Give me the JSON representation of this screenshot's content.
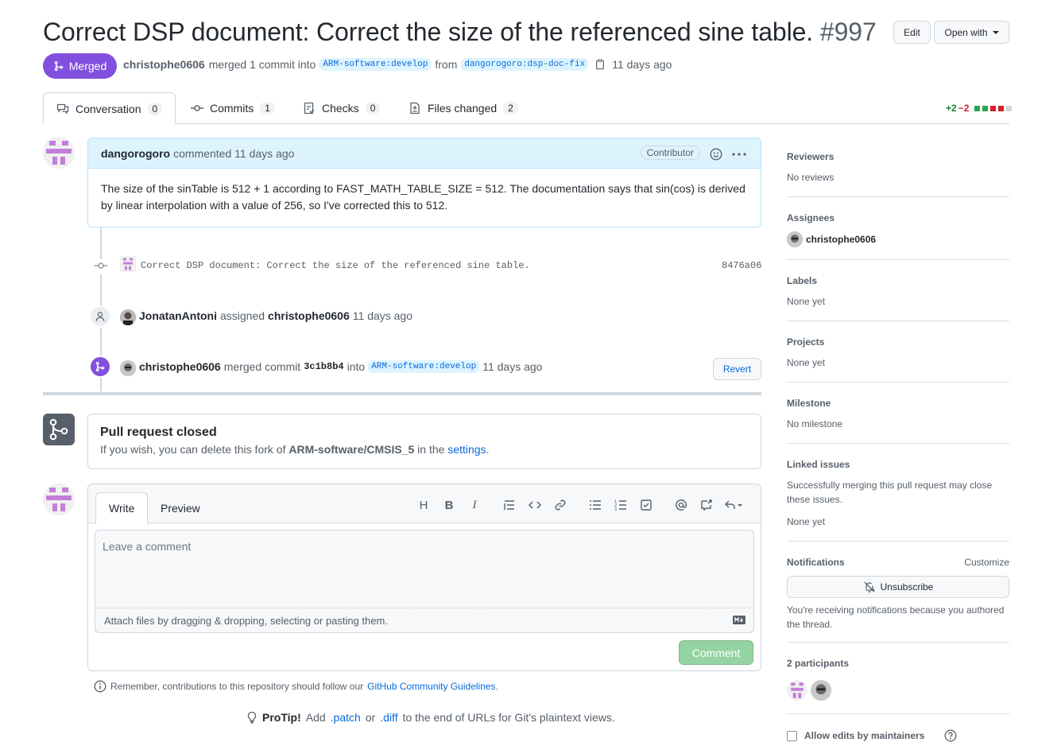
{
  "header": {
    "title": "Correct DSP document: Correct the size of the referenced sine table.",
    "number": "#997",
    "edit_label": "Edit",
    "open_with_label": "Open with"
  },
  "status": {
    "state": "Merged",
    "author": "christophe0606",
    "text_merged": "merged 1 commit into",
    "base_branch": "ARM-software:develop",
    "text_from": "from",
    "head_branch": "dangorogoro:dsp-doc-fix",
    "time": "11 days ago"
  },
  "tabs": [
    {
      "label": "Conversation",
      "count": "0"
    },
    {
      "label": "Commits",
      "count": "1"
    },
    {
      "label": "Checks",
      "count": "0"
    },
    {
      "label": "Files changed",
      "count": "2"
    }
  ],
  "diffstat": {
    "additions": "+2",
    "deletions": "−2"
  },
  "comment": {
    "author": "dangorogoro",
    "action": "commented 11 days ago",
    "role": "Contributor",
    "body": "The size of the sinTable is 512 + 1 according to FAST_MATH_TABLE_SIZE = 512. The documentation says that sin(cos) is derived by linear interpolation with a value of 256, so I've corrected this to 512."
  },
  "commit": {
    "message": "Correct DSP document: Correct the size of the referenced sine table.",
    "sha": "8476a06"
  },
  "assign_event": {
    "actor": "JonatanAntoni",
    "verb": "assigned",
    "target": "christophe0606",
    "time": "11 days ago"
  },
  "merge_event": {
    "actor": "christophe0606",
    "verb": "merged commit",
    "sha": "3c1b8b4",
    "into": "into",
    "branch": "ARM-software:develop",
    "time": "11 days ago",
    "revert_label": "Revert"
  },
  "closed": {
    "title": "Pull request closed",
    "text_before": "If you wish, you can delete this fork of",
    "repo": "ARM-software/CMSIS_5",
    "text_mid": "in the",
    "link": "settings",
    "text_after": "."
  },
  "form": {
    "write_tab": "Write",
    "preview_tab": "Preview",
    "placeholder": "Leave a comment",
    "attach_text": "Attach files by dragging & dropping, selecting or pasting them.",
    "comment_button": "Comment"
  },
  "remember": {
    "text": "Remember, contributions to this repository should follow our",
    "link": "GitHub Community Guidelines",
    "end": "."
  },
  "protip": {
    "label": "ProTip!",
    "t1": "Add",
    "patch": ".patch",
    "t2": "or",
    "diff": ".diff",
    "t3": "to the end of URLs for Git's plaintext views."
  },
  "sidebar": {
    "reviewers_h": "Reviewers",
    "reviewers_v": "No reviews",
    "assignees_h": "Assignees",
    "assignee": "christophe0606",
    "labels_h": "Labels",
    "labels_v": "None yet",
    "projects_h": "Projects",
    "projects_v": "None yet",
    "milestone_h": "Milestone",
    "milestone_v": "No milestone",
    "linked_h": "Linked issues",
    "linked_v": "Successfully merging this pull request may close these issues.",
    "linked_v2": "None yet",
    "notif_h": "Notifications",
    "customize": "Customize",
    "unsubscribe": "Unsubscribe",
    "notif_v": "You're receiving notifications because you authored the thread.",
    "participants_h": "2 participants",
    "allow_edits": "Allow edits by maintainers"
  },
  "colors": {
    "merged": "#8250df",
    "link": "#0969da",
    "add": "#1a7f37",
    "del": "#cf222e",
    "comment_button": "#94d3a2"
  }
}
